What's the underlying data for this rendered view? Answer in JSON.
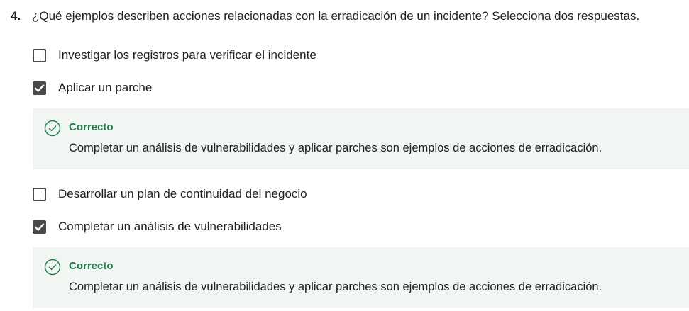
{
  "question": {
    "number": "4.",
    "text": "¿Qué ejemplos describen acciones relacionadas con la erradicación de un incidente? Selecciona dos respuestas."
  },
  "options": [
    {
      "label": "Investigar los registros para verificar el incidente",
      "checked": false
    },
    {
      "label": "Aplicar un parche",
      "checked": true
    },
    {
      "label": "Desarrollar un plan de continuidad del negocio",
      "checked": false
    },
    {
      "label": "Completar un análisis de vulnerabilidades",
      "checked": true
    }
  ],
  "feedback": [
    {
      "title": "Correcto",
      "text": "Completar un análisis de vulnerabilidades y aplicar parches son ejemplos de acciones de erradicación."
    },
    {
      "title": "Correcto",
      "text": "Completar un análisis de vulnerabilidades y aplicar parches son ejemplos de acciones de erradicación."
    }
  ],
  "colors": {
    "correct_green": "#1f7a4a",
    "feedback_bg": "#f1f6f3",
    "checkbox_checked": "#4a4a4a"
  }
}
